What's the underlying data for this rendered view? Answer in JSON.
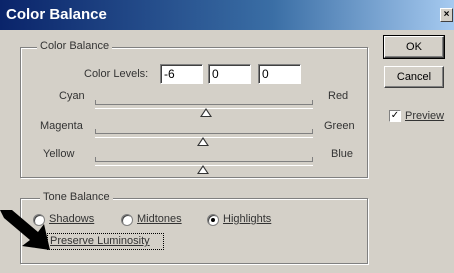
{
  "window": {
    "title": "Color Balance",
    "close_glyph": "×"
  },
  "color_balance": {
    "group_title": "Color Balance",
    "levels_label": "Color Levels:",
    "levels": [
      "-6",
      "0",
      "0"
    ],
    "sliders": [
      {
        "left": "Cyan",
        "right": "Red",
        "value": -6
      },
      {
        "left": "Magenta",
        "right": "Green",
        "value": 0
      },
      {
        "left": "Yellow",
        "right": "Blue",
        "value": 0
      }
    ]
  },
  "tone_balance": {
    "group_title": "Tone Balance",
    "options": [
      {
        "label": "Shadows",
        "selected": false
      },
      {
        "label": "Midtones",
        "selected": false
      },
      {
        "label": "Highlights",
        "selected": true
      }
    ],
    "preserve_label": "Preserve Luminosity",
    "preserve_checked": true
  },
  "buttons": {
    "ok": "OK",
    "cancel": "Cancel"
  },
  "preview": {
    "label": "Preview",
    "checked": true,
    "check_glyph": "✓"
  },
  "icons": {
    "pointer_arrow": "arrow-pointer-icon"
  },
  "colors": {
    "title_start": "#0a246a",
    "title_end": "#a6caf0",
    "face": "#d4d0c8"
  }
}
